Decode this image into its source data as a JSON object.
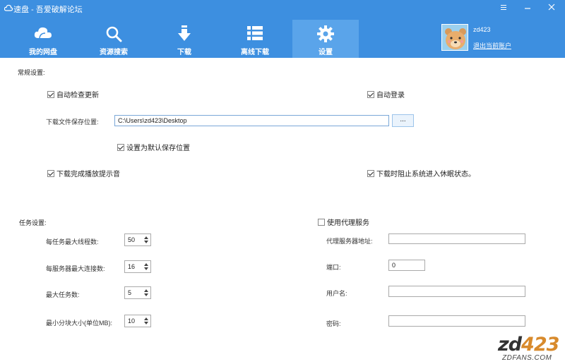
{
  "window": {
    "title": "速盘 - 吾爱破解论坛",
    "controls": [
      "menu-icon",
      "minimize-icon",
      "close-icon"
    ]
  },
  "nav": [
    {
      "label": "我的网盘",
      "icon": "cloud-icon"
    },
    {
      "label": "资源搜索",
      "icon": "search-icon"
    },
    {
      "label": "下载",
      "icon": "download-arrow-icon"
    },
    {
      "label": "离线下载",
      "icon": "list-icon"
    },
    {
      "label": "设置",
      "icon": "gear-icon",
      "active": true
    }
  ],
  "user": {
    "name": "zd423",
    "logout_label": "退出当前账户"
  },
  "general": {
    "title": "常规设置:",
    "auto_update": {
      "label": "自动检查更新",
      "checked": true
    },
    "auto_login": {
      "label": "自动登录",
      "checked": true
    },
    "save_path_label": "下载文件保存位置:",
    "save_path_value": "C:\\Users\\zd423\\Desktop",
    "browse_label": "...",
    "set_default": {
      "label": "设置为默认保存位置",
      "checked": true
    },
    "play_sound": {
      "label": "下载完成播放提示音",
      "checked": true
    },
    "prevent_sleep": {
      "label": "下载时阻止系统进入休眠状态。",
      "checked": true
    }
  },
  "task": {
    "title": "任务设置:",
    "max_threads": {
      "label": "每任务最大线程数:",
      "value": "50"
    },
    "max_connections": {
      "label": "每服务器最大连接数:",
      "value": "16"
    },
    "max_tasks": {
      "label": "最大任务数:",
      "value": "5"
    },
    "min_chunk": {
      "label": "最小分块大小(单位MB):",
      "value": "10"
    }
  },
  "proxy": {
    "use_proxy": {
      "label": "使用代理服务",
      "checked": false
    },
    "address_label": "代理服务器地址:",
    "address_value": "",
    "port_label": "端口:",
    "port_value": "0",
    "username_label": "用户名:",
    "username_value": "",
    "password_label": "密码:",
    "password_value": ""
  },
  "watermark": {
    "prefix": "zd",
    "number": "423",
    "domain": "ZDFANS.COM"
  }
}
